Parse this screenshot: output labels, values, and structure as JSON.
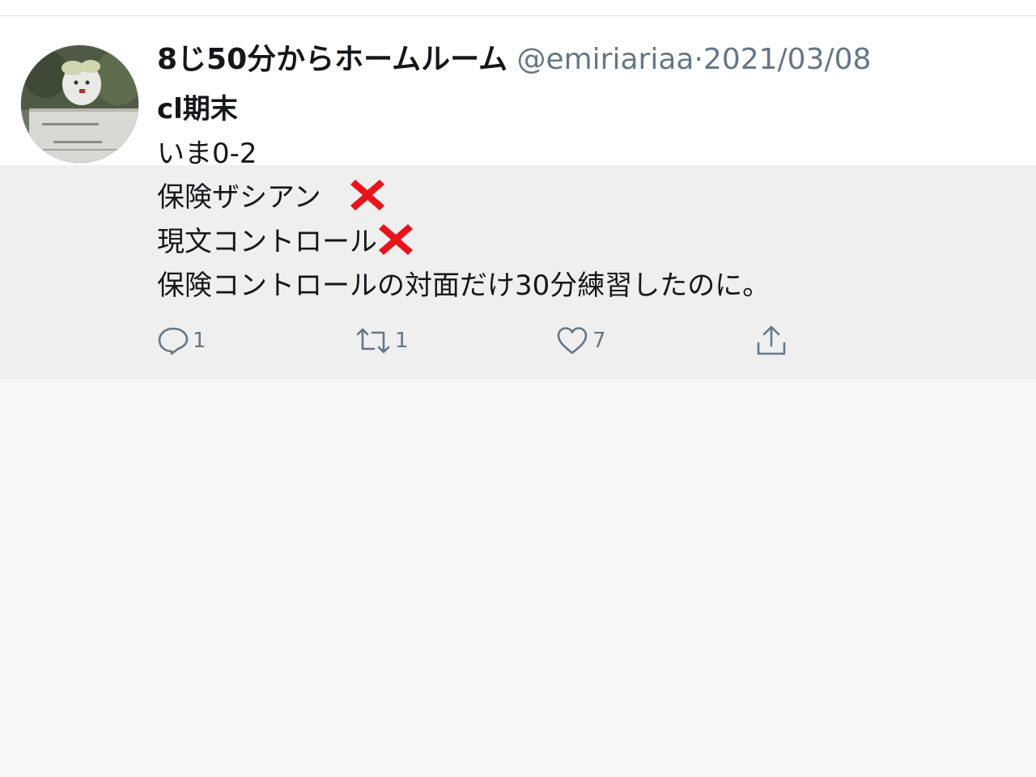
{
  "tweet": {
    "display_name": "8じ50分からホームルーム",
    "handle": "@emiriariaa",
    "separator": "·",
    "date": "2021/03/08",
    "lines": [
      "cl期末",
      "いま0-2",
      "保険ザシアン　",
      "現文コントロール",
      "保険コントロールの対面だけ30分練習したのに。"
    ],
    "actions": {
      "reply_count": "1",
      "retweet_count": "1",
      "like_count": "7"
    }
  },
  "icons": {
    "reply": "speech-bubble-icon",
    "retweet": "retweet-arrows-icon",
    "like": "heart-icon",
    "share": "share-upload-icon",
    "mark": "red-cross-mark-icon"
  },
  "colors": {
    "meta_gray": "#657786",
    "cross_red": "#e8141b",
    "highlight_bg": "#efeff0"
  }
}
